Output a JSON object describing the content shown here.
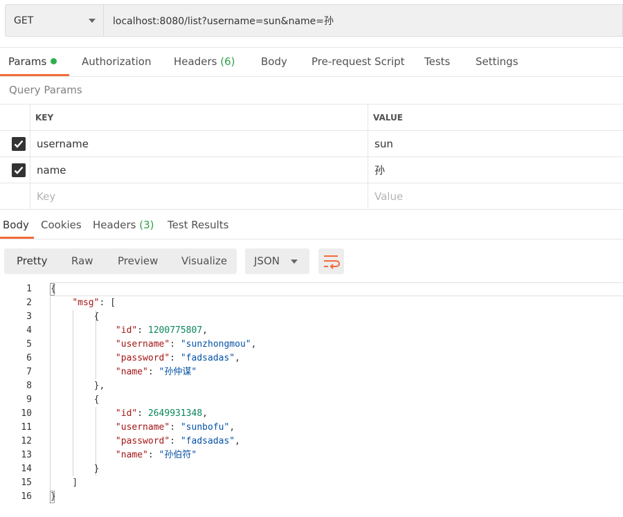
{
  "request": {
    "method": "GET",
    "url": "localhost:8080/list?username=sun&name=孙"
  },
  "request_tabs": {
    "params": "Params",
    "authorization": "Authorization",
    "headers": "Headers",
    "headers_count": "(6)",
    "body": "Body",
    "prerequest": "Pre-request Script",
    "tests": "Tests",
    "settings": "Settings"
  },
  "query_params": {
    "title": "Query Params",
    "key_header": "KEY",
    "value_header": "VALUE",
    "rows": [
      {
        "key": "username",
        "value": "sun",
        "checked": true
      },
      {
        "key": "name",
        "value": "孙",
        "checked": true
      }
    ],
    "key_placeholder": "Key",
    "value_placeholder": "Value"
  },
  "response_tabs": {
    "body": "Body",
    "cookies": "Cookies",
    "headers": "Headers",
    "headers_count": "(3)",
    "test_results": "Test Results"
  },
  "view": {
    "pretty": "Pretty",
    "raw": "Raw",
    "preview": "Preview",
    "visualize": "Visualize",
    "format": "JSON"
  },
  "colors": {
    "accent": "#f26b3a",
    "success": "#2fae4e",
    "json_key": "#a31515",
    "json_string": "#0451a5",
    "json_number": "#098658"
  },
  "response_body": {
    "line_numbers": [
      "1",
      "2",
      "3",
      "4",
      "5",
      "6",
      "7",
      "8",
      "9",
      "10",
      "11",
      "12",
      "13",
      "14",
      "15",
      "16"
    ],
    "msg_key": "\"msg\"",
    "items": [
      {
        "id_key": "\"id\"",
        "id": "1200775807",
        "username_key": "\"username\"",
        "username": "\"sunzhongmou\"",
        "password_key": "\"password\"",
        "password": "\"fadsadas\"",
        "name_key": "\"name\"",
        "name": "\"孙仲谋\""
      },
      {
        "id_key": "\"id\"",
        "id": "2649931348",
        "username_key": "\"username\"",
        "username": "\"sunbofu\"",
        "password_key": "\"password\"",
        "password": "\"fadsadas\"",
        "name_key": "\"name\"",
        "name": "\"孙伯符\""
      }
    ]
  }
}
